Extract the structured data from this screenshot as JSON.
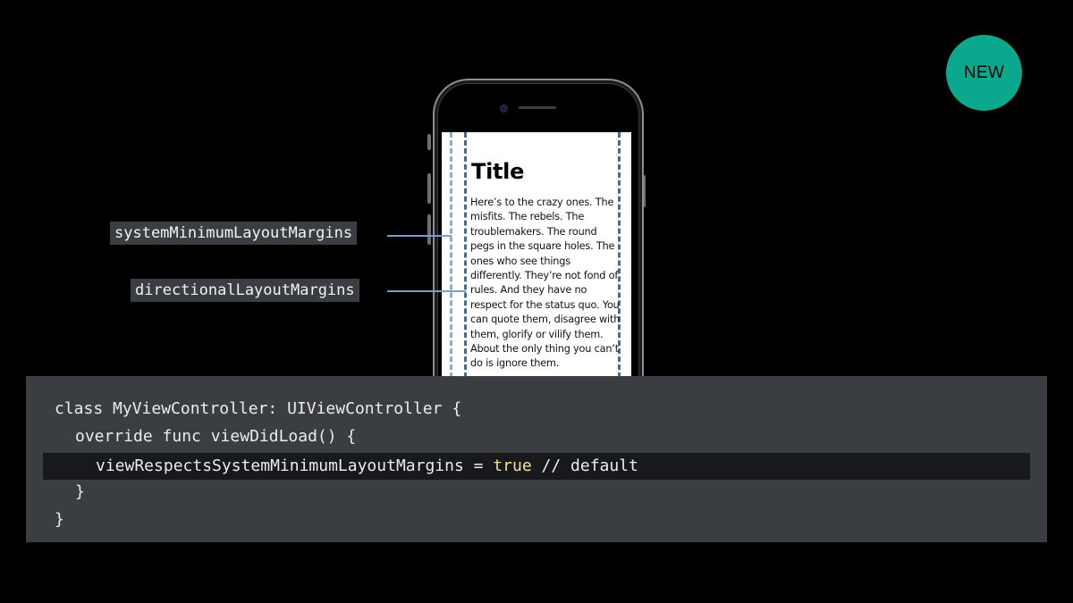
{
  "badge": {
    "label": "NEW",
    "color": "#0ba88e"
  },
  "screen": {
    "title": "Title",
    "body": "Here’s to the crazy ones. The misfits. The rebels. The troublemakers. The round pegs in the square holes. The ones who see things differently. They’re not fond of rules. And they have no respect for the status quo. You can quote them, disagree with them, glorify or vilify them. About the only thing you can’t do is ignore them."
  },
  "callouts": {
    "system": "systemMinimumLayoutMargins",
    "directional": "directionalLayoutMargins"
  },
  "code": {
    "line1": "class MyViewController: UIViewController {",
    "line2": "override func viewDidLoad() {",
    "line3_prefix": "viewRespectsSystemMinimumLayoutMargins = ",
    "line3_value": "true",
    "line3_comment": " // default",
    "line4": "}",
    "line5": "}"
  },
  "colors": {
    "background": "#000000",
    "code_panel": "#3a3d42",
    "highlight_row": "#17191c",
    "literal": "#f6e08a",
    "guide_directional": "#2f74a8",
    "guide_system": "#7fb1d3"
  },
  "icons": [
    "camera-icon",
    "speaker-icon"
  ]
}
